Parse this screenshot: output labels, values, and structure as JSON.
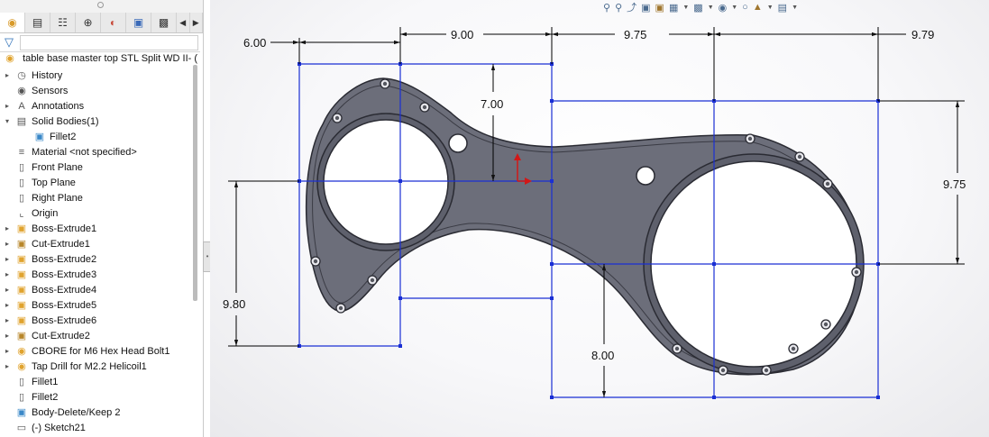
{
  "panel": {
    "tabs": [
      "feature-manager",
      "property-manager",
      "configuration-manager",
      "dimxpert-manager",
      "display-manager",
      "cam-manager",
      "appearances"
    ],
    "root_label": "table base master top STL Split WD II- (D",
    "tree": [
      {
        "label": "History",
        "icon": "history-icon",
        "expand": true
      },
      {
        "label": "Sensors",
        "icon": "sensor-icon",
        "expand": false
      },
      {
        "label": "Annotations",
        "icon": "annotation-icon",
        "expand": true
      },
      {
        "label": "Solid Bodies(1)",
        "icon": "folder-icon",
        "expand": "open"
      },
      {
        "label": "Fillet2",
        "icon": "solid-body-icon",
        "expand": false,
        "indent": true
      },
      {
        "label": "Material <not specified>",
        "icon": "material-icon",
        "expand": false
      },
      {
        "label": "Front Plane",
        "icon": "plane-icon",
        "expand": false
      },
      {
        "label": "Top Plane",
        "icon": "plane-icon",
        "expand": false
      },
      {
        "label": "Right Plane",
        "icon": "plane-icon",
        "expand": false
      },
      {
        "label": "Origin",
        "icon": "origin-icon",
        "expand": false
      },
      {
        "label": "Boss-Extrude1",
        "icon": "extrude-icon",
        "expand": true
      },
      {
        "label": "Cut-Extrude1",
        "icon": "cut-icon",
        "expand": true
      },
      {
        "label": "Boss-Extrude2",
        "icon": "extrude-icon",
        "expand": true
      },
      {
        "label": "Boss-Extrude3",
        "icon": "extrude-icon",
        "expand": true
      },
      {
        "label": "Boss-Extrude4",
        "icon": "extrude-icon",
        "expand": true
      },
      {
        "label": "Boss-Extrude5",
        "icon": "extrude-icon",
        "expand": true
      },
      {
        "label": "Boss-Extrude6",
        "icon": "extrude-icon",
        "expand": true
      },
      {
        "label": "Cut-Extrude2",
        "icon": "cut-icon",
        "expand": true
      },
      {
        "label": "CBORE for M6 Hex Head Bolt1",
        "icon": "hole-icon",
        "expand": true
      },
      {
        "label": "Tap Drill for M2.2 Helicoil1",
        "icon": "hole-icon",
        "expand": true
      },
      {
        "label": "Fillet1",
        "icon": "fillet-icon",
        "expand": false
      },
      {
        "label": "Fillet2",
        "icon": "fillet-icon",
        "expand": false
      },
      {
        "label": "Body-Delete/Keep 2",
        "icon": "body-delete-icon",
        "expand": false
      },
      {
        "label": "(-) Sketch21",
        "icon": "sketch-icon",
        "expand": false
      }
    ]
  },
  "dimensions": {
    "d1": "6.00",
    "d2": "9.00",
    "d3": "9.75",
    "d4": "9.79",
    "d5": "7.00",
    "d6": "9.75",
    "d7": "9.80",
    "d8": "8.00"
  },
  "colors": {
    "part_fill": "#6c6e7a",
    "part_edge": "#2a2b33",
    "sketch_line": "#1a2fd4",
    "dimension_line": "#000000"
  }
}
